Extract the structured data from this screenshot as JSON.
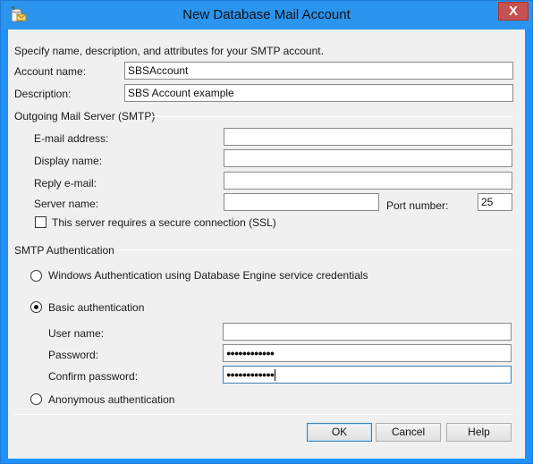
{
  "window": {
    "title": "New Database Mail Account",
    "close_label": "X"
  },
  "intro": "Specify name, description, and attributes for your SMTP account.",
  "account": {
    "name_label": "Account name:",
    "name_value": "SBSAccount",
    "description_label": "Description:",
    "description_value": "SBS Account example"
  },
  "smtp_server": {
    "group_label": "Outgoing Mail Server (SMTP)",
    "email_label": "E-mail address:",
    "email_value": "",
    "display_name_label": "Display name:",
    "display_name_value": "",
    "reply_email_label": "Reply e-mail:",
    "reply_email_value": "",
    "server_name_label": "Server name:",
    "server_name_value": "",
    "port_label": "Port number:",
    "port_value": "25",
    "ssl_label": "This server requires a secure connection (SSL)",
    "ssl_checked": false
  },
  "auth": {
    "group_label": "SMTP Authentication",
    "windows_label": "Windows Authentication using Database Engine service credentials",
    "basic_label": "Basic authentication",
    "selected": "basic",
    "username_label": "User name:",
    "username_value": "",
    "password_label": "Password:",
    "password_mask": "●●●●●●●●●●●●",
    "confirm_label": "Confirm password:",
    "confirm_mask": "●●●●●●●●●●●●",
    "anonymous_label": "Anonymous authentication"
  },
  "buttons": {
    "ok": "OK",
    "cancel": "Cancel",
    "help": "Help"
  }
}
